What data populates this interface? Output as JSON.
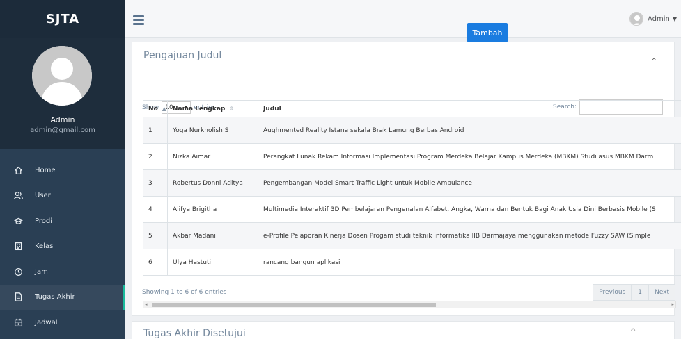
{
  "app": {
    "brand": "SJTA"
  },
  "profile": {
    "name": "Admin",
    "email": "admin@gmail.com"
  },
  "menu": [
    {
      "label": "Home",
      "icon": "home-icon"
    },
    {
      "label": "User",
      "icon": "users-icon"
    },
    {
      "label": "Prodi",
      "icon": "graduation-icon"
    },
    {
      "label": "Kelas",
      "icon": "building-icon"
    },
    {
      "label": "Jam",
      "icon": "clock-icon"
    },
    {
      "label": "Tugas Akhir",
      "icon": "document-icon",
      "active": true
    },
    {
      "label": "Jadwal",
      "icon": "calendar-icon"
    }
  ],
  "topbar": {
    "user": "Admin"
  },
  "panel": {
    "title": "Pengajuan Judul",
    "add_button": "Tambah",
    "show_label": "Show",
    "entries_value": "10",
    "entries_label": "entries",
    "search_label": "Search:",
    "search_value": "",
    "columns": [
      "No",
      "Nama Lengkap",
      "Judul"
    ],
    "rows": [
      {
        "no": "1",
        "nama": "Yoga Nurkholish S",
        "judul": "Aughmented Reality Istana sekala Brak Lamung Berbas   Android"
      },
      {
        "no": "2",
        "nama": "Nizka Aimar",
        "judul": "Perangkat Lunak Rekam Informasi Implementasi Program Merdeka Belajar Kampus Merdeka (MBKM) Studi asus MBKM Darm"
      },
      {
        "no": "3",
        "nama": "Robertus Donni Aditya",
        "judul": "Pengembangan Model Smart Traffic Light untuk Mobile Ambulance"
      },
      {
        "no": "4",
        "nama": "Alifya Brigitha",
        "judul": "Multimedia Interaktif 3D Pembelajaran Pengenalan Alfabet, Angka, Warna dan Bentuk Bagi Anak Usia Dini Berbasis Mobile (S"
      },
      {
        "no": "5",
        "nama": "Akbar Madani",
        "judul": "e-Profile Pelaporan Kinerja Dosen Progam studi teknik informatika IIB Darmajaya menggunakan metode Fuzzy SAW (Simple"
      },
      {
        "no": "6",
        "nama": "Ulya Hastuti",
        "judul": "rancang bangun aplikasi"
      }
    ],
    "info": "Showing 1 to 6 of 6 entries",
    "pager": {
      "previous": "Previous",
      "page": "1",
      "next": "Next"
    }
  },
  "panel2": {
    "title": "Tugas Akhir Disetujui"
  }
}
